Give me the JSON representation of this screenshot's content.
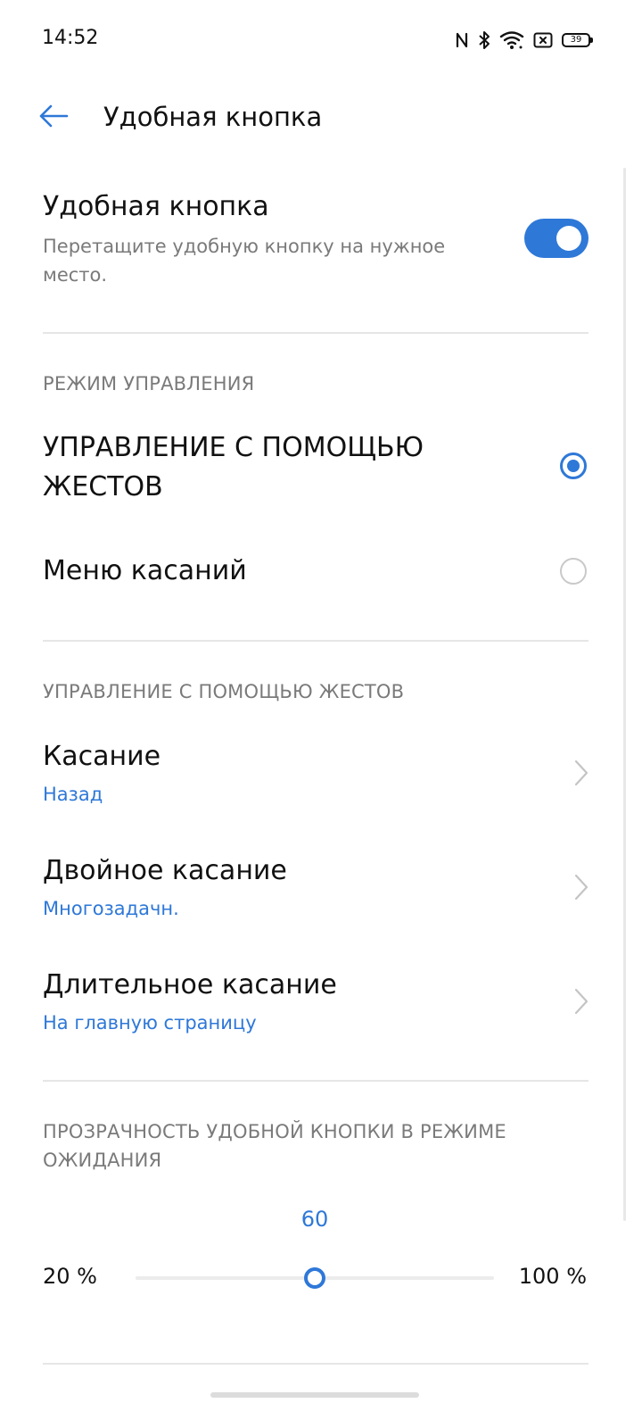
{
  "status_bar": {
    "time": "14:52",
    "battery": "39",
    "icons": [
      "nfc-icon",
      "bluetooth-icon",
      "wifi-icon",
      "sim-off-icon",
      "battery-icon"
    ]
  },
  "app_bar": {
    "title": "Удобная кнопка",
    "back_icon": "back-arrow-icon"
  },
  "main_toggle": {
    "title": "Удобная кнопка",
    "subtitle": "Перетащите удобную кнопку на нужное место.",
    "enabled": true
  },
  "control_mode": {
    "header": "РЕЖИМ УПРАВЛЕНИЯ",
    "options": [
      {
        "label": "УПРАВЛЕНИЕ С ПОМОЩЬЮ ЖЕСТОВ",
        "selected": true
      },
      {
        "label": "Меню касаний",
        "selected": false
      }
    ]
  },
  "gestures": {
    "header": "УПРАВЛЕНИЕ С ПОМОЩЬЮ ЖЕСТОВ",
    "items": [
      {
        "title": "Касание",
        "value": "Назад"
      },
      {
        "title": "Двойное касание",
        "value": "Многозадачн."
      },
      {
        "title": "Длительное касание",
        "value": "На главную страницу"
      }
    ]
  },
  "transparency": {
    "header": "ПРОЗРАЧНОСТЬ УДОБНОЙ КНОПКИ В РЕЖИМЕ ОЖИДАНИЯ",
    "value": "60",
    "min_label": "20 %",
    "max_label": "100 %",
    "min": 20,
    "max": 100,
    "current": 60
  },
  "colors": {
    "accent": "#2e78d8",
    "secondary_text": "#7a7a7a",
    "divider": "#e6e6e6"
  }
}
